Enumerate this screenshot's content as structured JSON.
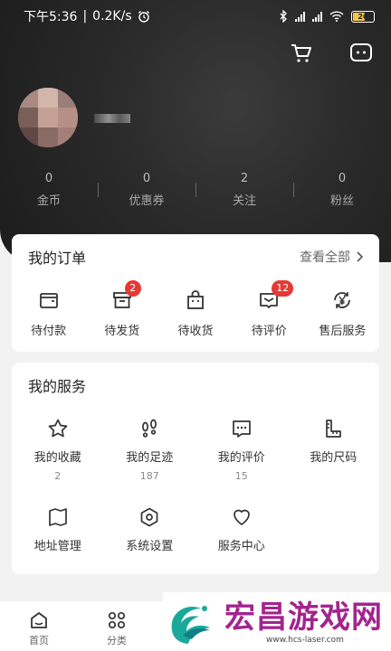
{
  "status_bar": {
    "time": "下午5:36",
    "speed": "0.2K/s",
    "battery": "26"
  },
  "stats": [
    {
      "value": "0",
      "label": "金币"
    },
    {
      "value": "0",
      "label": "优惠券"
    },
    {
      "value": "2",
      "label": "关注"
    },
    {
      "value": "0",
      "label": "粉丝"
    }
  ],
  "orders": {
    "title": "我的订单",
    "view_all": "查看全部",
    "items": [
      {
        "label": "待付款",
        "icon": "wallet-icon",
        "badge": ""
      },
      {
        "label": "待发货",
        "icon": "box-icon",
        "badge": "2"
      },
      {
        "label": "待收货",
        "icon": "bag-icon",
        "badge": ""
      },
      {
        "label": "待评价",
        "icon": "review-icon",
        "badge": "12"
      },
      {
        "label": "售后服务",
        "icon": "yen-refresh-icon",
        "badge": ""
      }
    ]
  },
  "services": {
    "title": "我的服务",
    "items": [
      {
        "label": "我的收藏",
        "count": "2",
        "icon": "star-icon"
      },
      {
        "label": "我的足迹",
        "count": "187",
        "icon": "footprint-icon"
      },
      {
        "label": "我的评价",
        "count": "15",
        "icon": "comment-icon"
      },
      {
        "label": "我的尺码",
        "count": "",
        "icon": "ruler-icon"
      },
      {
        "label": "地址管理",
        "count": "",
        "icon": "map-icon"
      },
      {
        "label": "系统设置",
        "count": "",
        "icon": "settings-icon"
      },
      {
        "label": "服务中心",
        "count": "",
        "icon": "heart-icon"
      }
    ]
  },
  "bottom_nav": [
    {
      "label": "首页",
      "icon": "home-icon"
    },
    {
      "label": "分类",
      "icon": "category-icon"
    }
  ],
  "watermark": {
    "title": "宏昌游戏网",
    "url": "www.hcs-laser.com"
  },
  "colors": {
    "badge": "#e53935",
    "watermark": "#a3248f",
    "header": "#2a2a2a"
  }
}
